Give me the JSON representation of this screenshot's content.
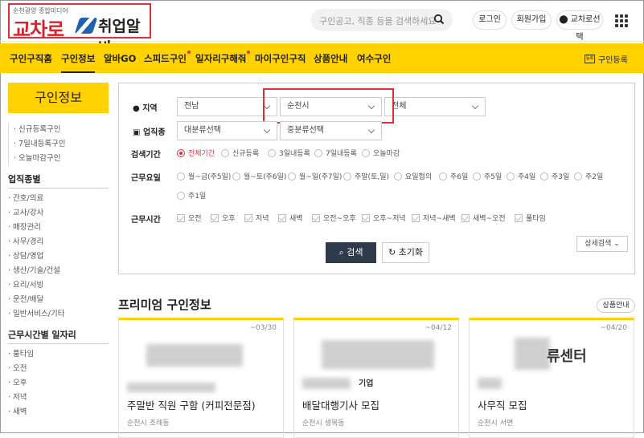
{
  "logo": {
    "tagline": "순천광양 종합미디어",
    "main": "교차로",
    "sub": "취업알바"
  },
  "search": {
    "placeholder": "구인공고, 직종 등을 검색하세요"
  },
  "header": {
    "login": "로그인",
    "signup": "회원가입",
    "region": "교차로선택"
  },
  "nav": {
    "items": [
      "구인구직홈",
      "구인정보",
      "알바GO",
      "스피드구인",
      "일자리구해줘",
      "마이구인구직",
      "상품안내",
      "여수구인"
    ],
    "register": "구인등록",
    "register_icon_text": "등록"
  },
  "sidebar": {
    "title": "구인정보",
    "top_items": [
      "신규등록구인",
      "7일내등록구인",
      "오늘마감구인"
    ],
    "jobs_head": "업직종별",
    "jobs": [
      "간호/의료",
      "교사/강사",
      "매장관리",
      "사무/경리",
      "상담/영업",
      "생산/기술/건설",
      "요리/서빙",
      "운전/배달",
      "일반서비스/기타"
    ],
    "time_head": "근무시간별 일자리",
    "times": [
      "풀타임",
      "오전",
      "오후",
      "저녁",
      "새벽"
    ]
  },
  "filters": {
    "region_label": "지역",
    "region_values": [
      "전남",
      "순천시",
      "전체"
    ],
    "job_label": "업직종",
    "job_values": [
      "대분류선택",
      "중분류선택"
    ],
    "period_label": "검색기간",
    "period_options": [
      "전체기간",
      "신규등록",
      "3일내등록",
      "7일내등록",
      "오늘마감"
    ],
    "day_label": "근무요일",
    "day_options": [
      "월~금(주5일)",
      "월~토(주6일)",
      "월~일(주7일)",
      "주말(토,일)",
      "요일협의",
      "주6일",
      "주5일",
      "주4일",
      "주3일",
      "주2일",
      "주1일"
    ],
    "time_label": "근무시간",
    "time_options": [
      "오전",
      "오후",
      "저녁",
      "새벽",
      "오전~오후",
      "오후~저녁",
      "저녁~새벽",
      "새벽~오전",
      "풀타임"
    ],
    "advanced": "상세검색",
    "search_btn": "검색",
    "reset_btn": "초기화"
  },
  "premium": {
    "title": "프리미엄 구인정보",
    "more": "상품안내",
    "cards": [
      {
        "date": "~03/30",
        "title": "주말반 직원 구함 (커피전문점)",
        "loc": "순천시 조례동",
        "partial": ""
      },
      {
        "date": "~04/12",
        "title": "배달대행기사 모집",
        "loc": "순천시 생목동",
        "partial": "기업"
      },
      {
        "date": "~04/20",
        "title": "사무직 모집",
        "loc": "순천시 서면",
        "partial": "류센터"
      }
    ]
  },
  "colors": {
    "accent": "#ffd200",
    "brand_red": "#d8232a",
    "dark_btn": "#2f3a4a"
  }
}
